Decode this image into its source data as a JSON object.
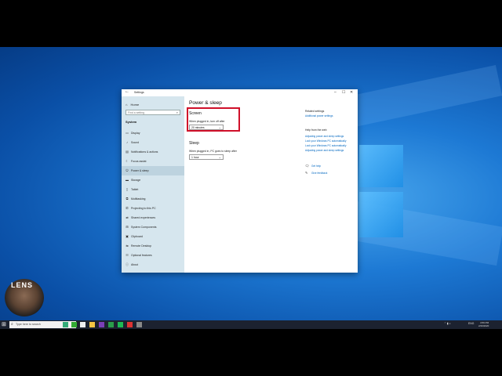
{
  "window": {
    "title": "Settings",
    "back_icon": "back-arrow-icon",
    "controls": [
      "–",
      "☐",
      "✕"
    ]
  },
  "sidebar": {
    "home_label": "Home",
    "search_placeholder": "Find a setting",
    "section_title": "System",
    "items": [
      {
        "label": "Display",
        "icon": "monitor-icon"
      },
      {
        "label": "Sound",
        "icon": "speaker-icon"
      },
      {
        "label": "Notifications & actions",
        "icon": "notification-icon"
      },
      {
        "label": "Focus assist",
        "icon": "moon-icon"
      },
      {
        "label": "Power & sleep",
        "icon": "power-icon",
        "active": true
      },
      {
        "label": "Storage",
        "icon": "storage-icon"
      },
      {
        "label": "Tablet",
        "icon": "tablet-icon"
      },
      {
        "label": "Multitasking",
        "icon": "multitasking-icon"
      },
      {
        "label": "Projecting to this PC",
        "icon": "projecting-icon"
      },
      {
        "label": "Shared experiences",
        "icon": "shared-icon"
      },
      {
        "label": "System Components",
        "icon": "components-icon"
      },
      {
        "label": "Clipboard",
        "icon": "clipboard-icon"
      },
      {
        "label": "Remote Desktop",
        "icon": "remote-icon"
      },
      {
        "label": "Optional features",
        "icon": "features-icon"
      },
      {
        "label": "About",
        "icon": "info-icon"
      }
    ]
  },
  "main": {
    "title": "Power & sleep",
    "screen": {
      "heading": "Screen",
      "label": "When plugged in, turn off after",
      "value": "20 minutes"
    },
    "sleep": {
      "heading": "Sleep",
      "label": "When plugged in, PC goes to sleep after",
      "value": "1 hour"
    }
  },
  "related": {
    "heading": "Related settings",
    "link": "Additional power settings",
    "help_heading": "Help from the web",
    "help_links": [
      "Adjusting power and sleep settings",
      "Lock your Windows PC automatically",
      "Lock your Windows PC automatically",
      "Adjusting power and sleep settings"
    ],
    "get_help": "Get help",
    "feedback": "Give feedback"
  },
  "overlay": {
    "channel_text": "LENS"
  },
  "taskbar": {
    "search_placeholder": "Type here to search",
    "tray_time": "4:59 PM",
    "tray_date": "2/20/2020",
    "tray_lang": "ENG"
  }
}
